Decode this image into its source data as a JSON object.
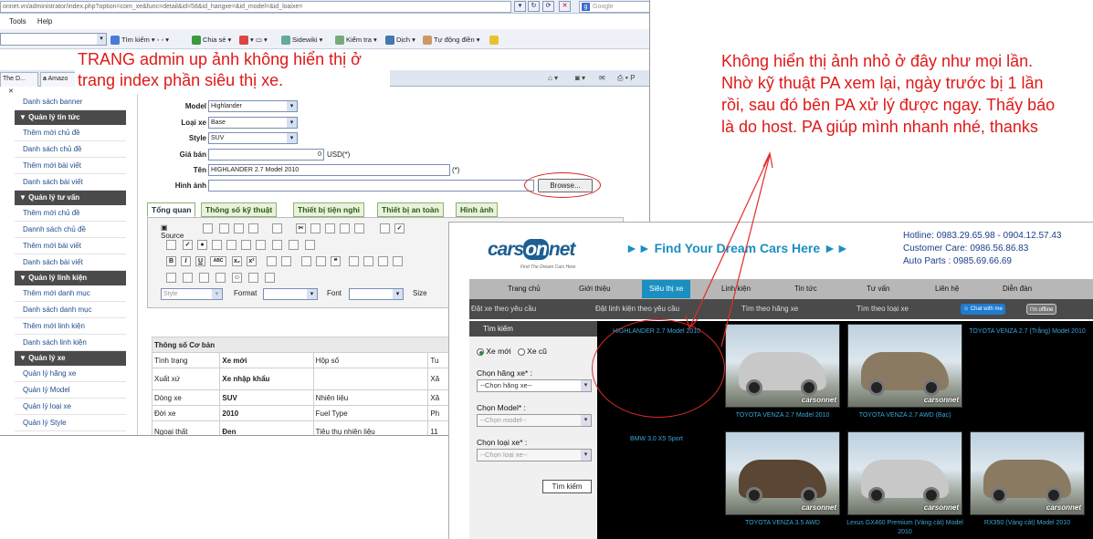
{
  "browser": {
    "url": "onnet.vn/administrator/index.php?option=com_xe&func=detail&id=58&id_hangxe=&id_model=&id_loaixe=",
    "google_placeholder": "Google",
    "menu": [
      "Tools",
      "Help"
    ],
    "toolbar": [
      "Tìm kiếm",
      "Chia sẻ",
      "Sidewiki",
      "Kiểm tra",
      "Dịch",
      "Tự động điền"
    ],
    "tabs": [
      "The D...",
      "Amazo"
    ]
  },
  "annotations": {
    "left": "TRANG admin up ảnh không hiển thị ở trang index phần siêu thị xe.",
    "right": "Không hiển thị ảnh nhỏ ở đây như mọi lần. Nhờ kỹ thuật PA xem lại, ngày trước bị 1 lần rồi, sau đó bên PA xử lý được ngay. Thấy báo là do host. PA giúp mình nhanh nhé, thanks"
  },
  "admin_sidebar": [
    {
      "type": "link",
      "label": "Danh sách banner"
    },
    {
      "type": "head",
      "label": "▼ Quản lý tin tức"
    },
    {
      "type": "link",
      "label": "Thêm mới chủ đề"
    },
    {
      "type": "link",
      "label": "Danh sách chủ đề"
    },
    {
      "type": "link",
      "label": "Thêm mới bài viết"
    },
    {
      "type": "link",
      "label": "Danh sách bài viết"
    },
    {
      "type": "head",
      "label": "▼ Quản lý tư vấn"
    },
    {
      "type": "link",
      "label": "Thêm mới chủ đề"
    },
    {
      "type": "link",
      "label": "Dannh sách chủ đề"
    },
    {
      "type": "link",
      "label": "Thêm mới bài viết"
    },
    {
      "type": "link",
      "label": "Danh sách bài viết"
    },
    {
      "type": "head",
      "label": "▼ Quản lý linh kiện"
    },
    {
      "type": "link",
      "label": "Thêm mới danh mục"
    },
    {
      "type": "link",
      "label": "Danh sách danh mục"
    },
    {
      "type": "link",
      "label": "Thêm mới linh kiện"
    },
    {
      "type": "link",
      "label": "Danh sách linh kiện"
    },
    {
      "type": "head",
      "label": "▼ Quản lý xe"
    },
    {
      "type": "link",
      "label": "Quản lý hãng xe"
    },
    {
      "type": "link",
      "label": "Quản lý Model"
    },
    {
      "type": "link",
      "label": "Quản lý loại xe"
    },
    {
      "type": "link",
      "label": "Quản lý Style"
    }
  ],
  "form": {
    "model_label": "Model",
    "model_value": "Highlander",
    "loaixe_label": "Loại xe",
    "loaixe_value": "Base",
    "style_label": "Style",
    "style_value": "SUV",
    "giaban_label": "Giá bán",
    "giaban_value": "0",
    "giaban_unit": "USD(*)",
    "ten_label": "Tên",
    "ten_value": "HIGHLANDER 2.7 Model 2010",
    "ten_req": "(*)",
    "hinhanh_label": "Hình ảnh",
    "browse": "Browse..."
  },
  "editor_tabs": [
    "Tổng quan",
    "Thông số kỹ thuật",
    "Thiết bị tiện nghi",
    "Thiết bị an toàn",
    "Hình ảnh"
  ],
  "editor": {
    "source": "Source",
    "style_ph": "Style",
    "format_ph": "Format",
    "font_ph": "Font",
    "size_ph": "Size",
    "b": "B",
    "i": "I",
    "u": "U",
    "abc": "ABC",
    "sub": "x₂",
    "sup": "x²"
  },
  "specs": {
    "title": "Thông số Cơ bản",
    "rows": [
      [
        "Tình trạng",
        "Xe mới",
        "Hộp số",
        "Tu"
      ],
      [
        "Xuất xứ",
        "Xe nhập khẩu",
        "",
        "Xă"
      ],
      [
        "Dòng xe",
        "SUV",
        "Nhiên liệu",
        "Xă"
      ],
      [
        "Đời xe",
        "2010",
        "Fuel Type",
        "Ph"
      ],
      [
        "Ngoại thất",
        "Đen",
        "Tiêu thụ nhiên liệu",
        "11"
      ]
    ]
  },
  "site": {
    "logo_a": "cars",
    "logo_b": "on",
    "logo_c": "net",
    "logo_sub": "Find The Dream Cars Here",
    "tagline": "►►  Find Your Dream Cars Here ►►",
    "hotline": "Hotline: 0983.29.65.98 - 0904.12.57.43",
    "care": "Customer Care: 0986.56.86.83",
    "parts": "Auto Parts : 0985.69.66.69",
    "nav": [
      "Trang chủ",
      "Giới thiệu",
      "Siêu thị xe",
      "Linh kiện",
      "Tin tức",
      "Tư vấn",
      "Liên hệ",
      "Diễn đàn"
    ],
    "subnav": [
      "Đặt xe theo yêu cầu",
      "Đặt linh kiện theo yêu cầu",
      "Tìm theo hãng xe",
      "Tìm theo loại xe"
    ],
    "chat": "Chat with me",
    "offline": "I'm offline",
    "search_title": "Tìm kiếm",
    "new_label": "Xe mới",
    "used_label": "Xe cũ",
    "brand_label": "Chọn hãng xe* :",
    "brand_value": "--Chọn hãng xe--",
    "model_label": "Chọn Model* :",
    "model_value": "--Chọn model--",
    "type_label": "Chọn loại xe* :",
    "type_value": "--Chọn loại xe--",
    "search_btn": "Tìm kiếm",
    "watermark": "carsonnet",
    "products": [
      {
        "name": "HIGHLANDER 2.7 Model 2010",
        "image": false
      },
      {
        "name": "TOYOTA VENZA 2.7 Model 2010",
        "image": true
      },
      {
        "name": "TOYOTA VENZA 2.7 AWD (Bạc)",
        "image": true
      },
      {
        "name": "TOYOTA VENZA 2.7 (Trắng) Model 2010",
        "image": false
      },
      {
        "name": "BMW 3.0 X5 Sport",
        "image": false
      },
      {
        "name": "TOYOTA VENZA 3.5 AWD",
        "image": true
      },
      {
        "name": "Lexus GX460 Premium (Vàng cát) Model 2010",
        "image": true
      },
      {
        "name": "RX350 (Vàng cát) Model 2010",
        "image": true
      }
    ]
  }
}
